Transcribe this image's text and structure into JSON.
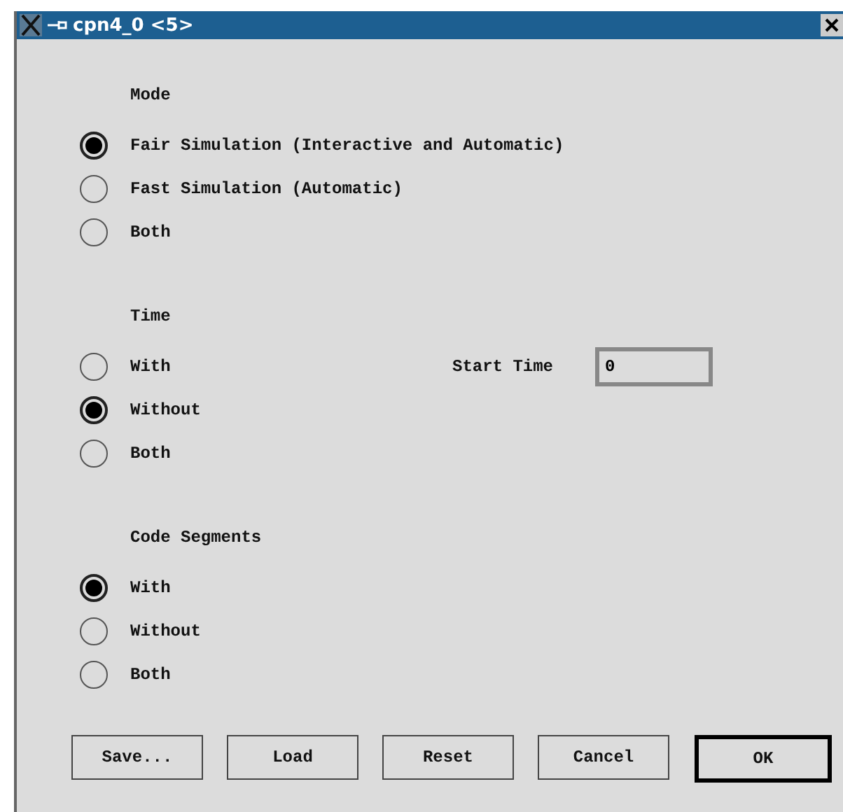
{
  "window": {
    "title": "cpn4_0 <5>"
  },
  "groups": [
    {
      "label": "Mode",
      "options": [
        {
          "label": "Fair Simulation (Interactive and Automatic)",
          "selected": true
        },
        {
          "label": "Fast Simulation (Automatic)",
          "selected": false
        },
        {
          "label": "Both",
          "selected": false
        }
      ]
    },
    {
      "label": "Time",
      "field": {
        "label": "Start Time",
        "value": "0"
      },
      "options": [
        {
          "label": "With",
          "selected": false
        },
        {
          "label": "Without",
          "selected": true
        },
        {
          "label": "Both",
          "selected": false
        }
      ]
    },
    {
      "label": "Code Segments",
      "options": [
        {
          "label": "With",
          "selected": true
        },
        {
          "label": "Without",
          "selected": false
        },
        {
          "label": "Both",
          "selected": false
        }
      ]
    }
  ],
  "buttons": [
    {
      "label": "Save...",
      "default": false
    },
    {
      "label": "Load",
      "default": false
    },
    {
      "label": "Reset",
      "default": false
    },
    {
      "label": "Cancel",
      "default": false
    },
    {
      "label": "OK",
      "default": true
    }
  ]
}
